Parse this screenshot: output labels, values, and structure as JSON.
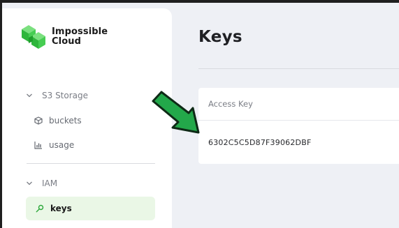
{
  "brand": {
    "line1": "Impossible",
    "line2": "Cloud",
    "color": "#3ec64a"
  },
  "sidebar": {
    "sections": [
      {
        "label": "S3 Storage",
        "items": [
          {
            "label": "buckets",
            "icon": "cube-icon"
          },
          {
            "label": "usage",
            "icon": "bar-chart-icon"
          }
        ]
      },
      {
        "label": "IAM",
        "items": [
          {
            "label": "keys",
            "icon": "key-icon",
            "active": true
          }
        ]
      }
    ]
  },
  "main": {
    "title": "Keys",
    "table": {
      "header": "Access Key",
      "rows": [
        "6302C5C5D87F39062DBF"
      ]
    }
  },
  "annotation": {
    "icon": "pointer-arrow-icon",
    "color": "#23a84a"
  }
}
